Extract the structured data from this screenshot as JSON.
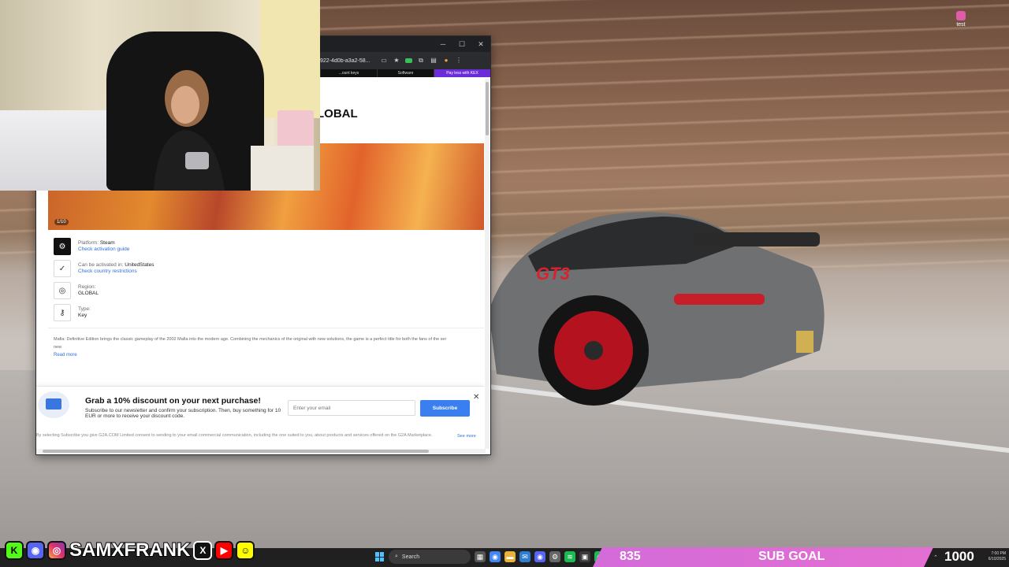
{
  "desktop": {
    "icon_label": "test"
  },
  "browser": {
    "url": "922-4d0b-a3a2-58...",
    "nav_tabs": [
      "...ount keys",
      "Software",
      "Pay less with KEX"
    ],
    "product_title": "LOBAL",
    "gallery_counter": "1/10",
    "info": [
      {
        "icon": "steam-icon",
        "label": "Platform:",
        "value": "Steam",
        "link": "Check activation guide"
      },
      {
        "icon": "check-circle-icon",
        "label": "Can be activated in:",
        "value": "UnitedStates",
        "link": "Check country restrictions"
      },
      {
        "icon": "globe-icon",
        "label": "Region:",
        "value": "GLOBAL",
        "link": ""
      },
      {
        "icon": "key-icon",
        "label": "Type:",
        "value": "Key",
        "link": ""
      }
    ],
    "description": "Mafia: Definitive Edition brings the classic gameplay of the 2002 Mafia into the modern age. Combining the mechanics of the original with new solutions, the game is a perfect title for both the fans of the ser",
    "description_cont": "new",
    "read_more": "Read more",
    "promo": {
      "title": "Grab a 10% discount on your next purchase!",
      "subtitle": "Subscribe to our newsletter and confirm your subscription. Then, buy something for 10 EUR or more to receive your discount code.",
      "email_placeholder": "Enter your email",
      "subscribe_label": "Subscribe",
      "consent": "By selecting Subscribe you give G2A.COM Limited consent to sending to your email commercial communication, including the one suited to you, about products and services offered on the G2A Marketplace.",
      "see_more": "See more"
    }
  },
  "overlay": {
    "handle": "SAMXFRANK",
    "sub_goal_current": "835",
    "sub_goal_label": "SUB GOAL",
    "sub_goal_total": "1000",
    "sub_goal_progress": 0.835
  },
  "taskbar": {
    "search_label": "Search",
    "time": "7:00 PM",
    "date": "6/10/2025"
  },
  "colors": {
    "accent_blue": "#3a7ff0",
    "sub_goal_pink": "#d36bd8",
    "kick_green": "#53fc18"
  }
}
